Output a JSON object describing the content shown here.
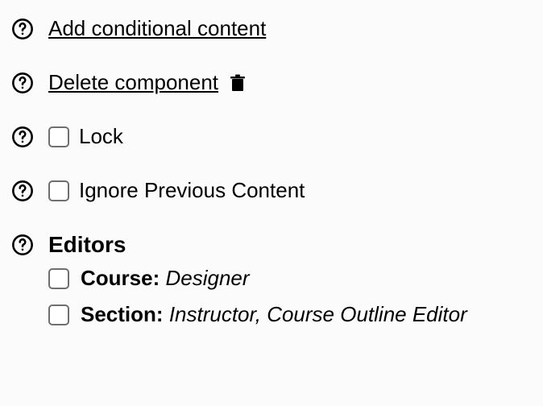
{
  "links": {
    "add_conditional": "Add conditional content",
    "delete_component": "Delete component"
  },
  "options": {
    "lock": "Lock",
    "ignore_previous": "Ignore Previous Content"
  },
  "editors": {
    "heading": "Editors",
    "items": [
      {
        "scope": "Course:",
        "value": "Designer"
      },
      {
        "scope": "Section:",
        "value": "Instructor, Course Outline Editor"
      }
    ]
  }
}
